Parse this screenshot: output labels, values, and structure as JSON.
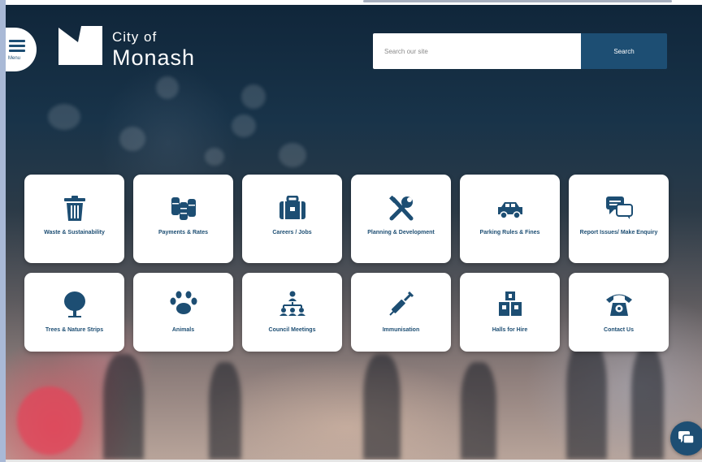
{
  "header": {
    "menu_label": "Menu",
    "logo": {
      "line1": "City of",
      "line2": "Monash"
    }
  },
  "search": {
    "placeholder": "Search our site",
    "button_label": "Search"
  },
  "tiles": [
    {
      "label": "Waste & Sustainability",
      "icon": "trash-bin-icon"
    },
    {
      "label": "Payments & Rates",
      "icon": "coins-icon"
    },
    {
      "label": "Careers / Jobs",
      "icon": "briefcase-icon"
    },
    {
      "label": "Planning & Development",
      "icon": "tools-icon"
    },
    {
      "label": "Parking Rules & Fines",
      "icon": "car-icon"
    },
    {
      "label": "Report Issues/ Make Enquiry",
      "icon": "chat-bubbles-icon"
    },
    {
      "label": "Trees & Nature Strips",
      "icon": "tree-icon"
    },
    {
      "label": "Animals",
      "icon": "paw-icon"
    },
    {
      "label": "Council Meetings",
      "icon": "org-chart-icon"
    },
    {
      "label": "Immunisation",
      "icon": "syringe-icon"
    },
    {
      "label": "Halls for Hire",
      "icon": "building-blocks-icon"
    },
    {
      "label": "Contact Us",
      "icon": "telephone-icon"
    }
  ],
  "chat": {
    "icon": "chat-icon"
  },
  "colors": {
    "brand": "#1d4e73",
    "tile_bg": "#ffffff"
  }
}
